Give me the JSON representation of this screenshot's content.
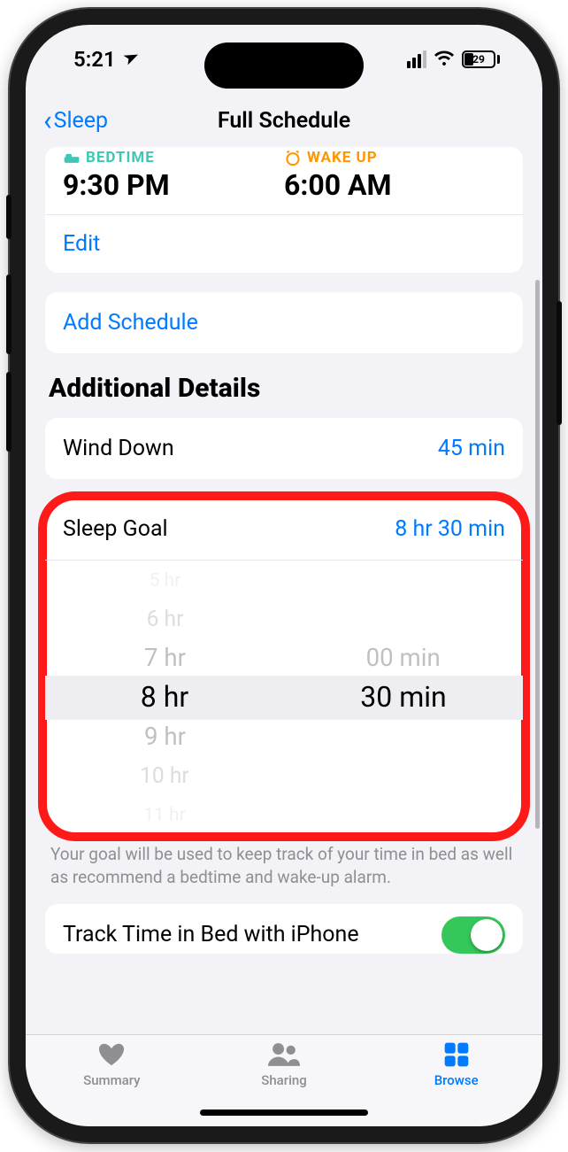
{
  "status": {
    "time": "5:21",
    "battery": "29"
  },
  "nav": {
    "back": "Sleep",
    "title": "Full Schedule"
  },
  "schedule": {
    "bedtime_label": "BEDTIME",
    "bedtime": "9:30 PM",
    "wakeup_label": "WAKE UP",
    "wakeup": "6:00 AM",
    "edit": "Edit",
    "add": "Add Schedule"
  },
  "details": {
    "header": "Additional Details",
    "wind_down": {
      "label": "Wind Down",
      "value": "45 min"
    },
    "sleep_goal": {
      "label": "Sleep Goal",
      "value": "8 hr 30 min",
      "hours": [
        "5 hr",
        "6 hr",
        "7 hr",
        "8 hr",
        "9 hr",
        "10 hr",
        "11 hr"
      ],
      "minutes": [
        "00 min",
        "30 min"
      ]
    },
    "help": "Your goal will be used to keep track of your time in bed as well as recommend a bedtime and wake-up alarm.",
    "track": {
      "label": "Track Time in Bed with iPhone",
      "on": true
    }
  },
  "tabs": {
    "summary": "Summary",
    "sharing": "Sharing",
    "browse": "Browse"
  }
}
